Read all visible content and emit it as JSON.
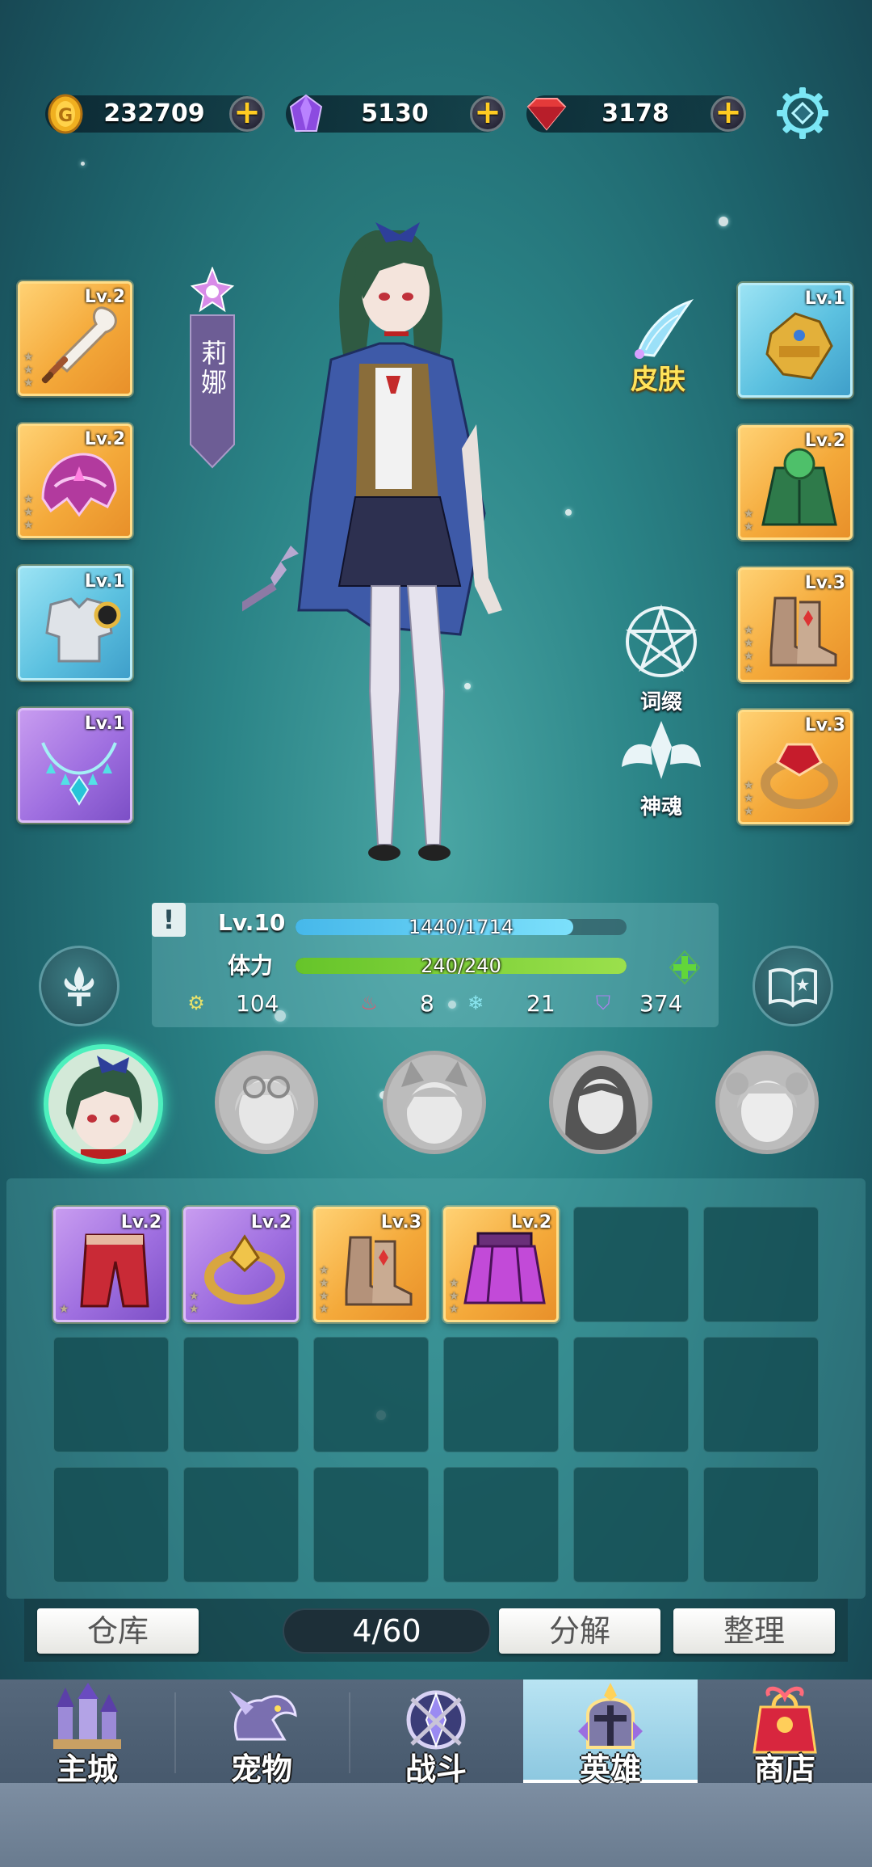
{
  "currency": {
    "gold": "232709",
    "crystal": "5130",
    "ruby": "3178"
  },
  "hero": {
    "name": "莉娜",
    "skin_label": "皮肤",
    "affix_label": "词缀",
    "soul_label": "神魂"
  },
  "equipment_left": [
    {
      "level": "Lv.2",
      "rarity": "gold",
      "icon": "sword-icon"
    },
    {
      "level": "Lv.2",
      "rarity": "gold",
      "icon": "helmet-icon"
    },
    {
      "level": "Lv.1",
      "rarity": "blue",
      "icon": "chest-armor-icon"
    },
    {
      "level": "Lv.1",
      "rarity": "purple",
      "icon": "necklace-icon"
    }
  ],
  "equipment_right": [
    {
      "level": "Lv.1",
      "rarity": "blue",
      "icon": "gauntlet-icon"
    },
    {
      "level": "Lv.2",
      "rarity": "gold",
      "icon": "cloak-icon"
    },
    {
      "level": "Lv.3",
      "rarity": "gold",
      "icon": "boots-icon"
    },
    {
      "level": "Lv.3",
      "rarity": "gold",
      "icon": "ring-icon"
    }
  ],
  "stats": {
    "level": "Lv.10",
    "exp_text": "1440/1714",
    "exp_fraction": 0.84,
    "stamina_label": "体力",
    "stamina_text": "240/240",
    "stamina_fraction": 1.0,
    "attack": "104",
    "fire": "8",
    "ice": "21",
    "defense": "374"
  },
  "inventory": {
    "items": [
      {
        "level": "Lv.2",
        "rarity": "purple",
        "icon": "pants-icon"
      },
      {
        "level": "Lv.2",
        "rarity": "purple",
        "icon": "ring-icon"
      },
      {
        "level": "Lv.3",
        "rarity": "gold",
        "icon": "boots-icon"
      },
      {
        "level": "Lv.2",
        "rarity": "gold",
        "icon": "skirt-armor-icon"
      }
    ],
    "count": "4/60",
    "warehouse_label": "仓库",
    "decompose_label": "分解",
    "sort_label": "整理"
  },
  "nav": {
    "tabs": [
      {
        "label": "主城",
        "icon": "castle-icon"
      },
      {
        "label": "宠物",
        "icon": "dragon-icon"
      },
      {
        "label": "战斗",
        "icon": "battle-icon"
      },
      {
        "label": "英雄",
        "icon": "knight-helmet-icon"
      },
      {
        "label": "商店",
        "icon": "gift-bag-icon"
      }
    ],
    "active": "英雄"
  },
  "colors": {
    "exp_bar": "#56c8f0",
    "stamina_bar": "#7ed23a",
    "selected_glow": "#4df0bd",
    "currency_plus": "#ffcc22"
  }
}
